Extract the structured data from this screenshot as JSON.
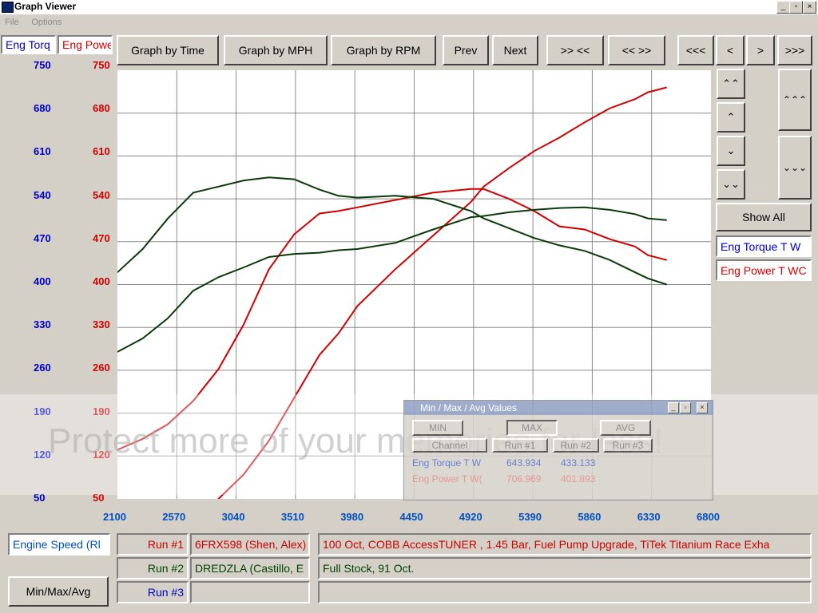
{
  "window": {
    "title": "Graph Viewer",
    "controls": [
      "_",
      "▫",
      "×"
    ]
  },
  "menu": [
    "File",
    "Options"
  ],
  "channels": {
    "torque": "Eng Torq",
    "power": "Eng Powe"
  },
  "toolbar": {
    "by_time": "Graph by Time",
    "by_mph": "Graph by MPH",
    "by_rpm": "Graph by RPM",
    "prev": "Prev",
    "next": "Next",
    "zoom_in": ">> <<",
    "zoom_out": "<< >>",
    "first": "<<<",
    "left": "<",
    "right": ">",
    "last": ">>>"
  },
  "side": {
    "show_all": "Show All",
    "legend_torque": "Eng Torque T W",
    "legend_power": "Eng Power T WC",
    "up2": "⌃⌃",
    "up1": "⌃",
    "down1": "⌄",
    "down2": "⌄⌄",
    "up3": "⌃⌃⌃",
    "down3": "⌄⌄⌄"
  },
  "axes": {
    "y_ticks": [
      "750",
      "680",
      "610",
      "540",
      "470",
      "400",
      "330",
      "260",
      "190",
      "120",
      "50"
    ],
    "x_ticks": [
      "2100",
      "2570",
      "3040",
      "3510",
      "3980",
      "4450",
      "4920",
      "5390",
      "5860",
      "6330",
      "6800"
    ]
  },
  "colors": {
    "torque_axis": "#0000c8",
    "power_axis": "#d00000",
    "run1": "#cc0000",
    "run2": "#004400",
    "plot_bg": "#ffffff"
  },
  "chart_data": {
    "type": "line",
    "xlabel": "Engine Speed",
    "ylim": [
      50,
      750
    ],
    "xlim": [
      2100,
      6800
    ],
    "grid": true,
    "series": [
      {
        "name": "Eng Power T WC (Run #1)",
        "x": [
          2100,
          2300,
          2500,
          2700,
          2900,
          3100,
          3300,
          3500,
          3700,
          3850,
          4000,
          4300,
          4600,
          4900,
          5000,
          5200,
          5400,
          5600,
          5800,
          6000,
          6200,
          6300,
          6450
        ],
        "y": [
          -50,
          -25,
          -5,
          20,
          50,
          90,
          145,
          215,
          285,
          320,
          365,
          425,
          480,
          535,
          560,
          590,
          618,
          640,
          665,
          688,
          703,
          714,
          722
        ]
      },
      {
        "name": "Eng Power T WC (Run #2)",
        "x": [
          2100,
          2300,
          2500,
          2700,
          2900,
          3100,
          3300,
          3500,
          3700,
          3850,
          4000,
          4300,
          4600,
          4900,
          5000,
          5200,
          5400,
          5600,
          5800,
          6000,
          6200,
          6300,
          6450
        ],
        "y": [
          130,
          148,
          172,
          210,
          262,
          335,
          425,
          482,
          516,
          520,
          526,
          538,
          550,
          556,
          556,
          540,
          520,
          495,
          490,
          474,
          462,
          448,
          440
        ]
      },
      {
        "name": "Eng Torque T W (Run #1)",
        "x": [
          2100,
          2300,
          2500,
          2700,
          2900,
          3100,
          3300,
          3500,
          3700,
          3850,
          4000,
          4300,
          4600,
          4900,
          5000,
          5200,
          5400,
          5600,
          5800,
          6000,
          6200,
          6300,
          6450
        ],
        "y": [
          290,
          312,
          345,
          390,
          412,
          428,
          445,
          450,
          452,
          456,
          458,
          468,
          490,
          510,
          512,
          518,
          522,
          525,
          526,
          522,
          515,
          508,
          505
        ]
      },
      {
        "name": "Eng Torque T W (Run #2)",
        "x": [
          2100,
          2300,
          2500,
          2700,
          2900,
          3100,
          3300,
          3500,
          3700,
          3850,
          4000,
          4300,
          4600,
          4900,
          5000,
          5200,
          5400,
          5600,
          5800,
          6000,
          6200,
          6300,
          6450
        ],
        "y": [
          420,
          458,
          508,
          550,
          560,
          570,
          575,
          572,
          555,
          545,
          542,
          545,
          540,
          520,
          508,
          492,
          476,
          464,
          455,
          440,
          420,
          410,
          400
        ]
      }
    ]
  },
  "dialog": {
    "title": "Min / Max / Avg Values",
    "min": "MIN",
    "max": "MAX",
    "avg": "AVG",
    "headers": [
      "Channel",
      "Run #1",
      "Run #2",
      "Run #3"
    ],
    "rows": [
      {
        "channel": "Eng Torque T W",
        "run1": "643.934",
        "run2": "433.133"
      },
      {
        "channel": "Eng Power T W(",
        "run1": "706.969",
        "run2": "401.893"
      }
    ]
  },
  "bottom": {
    "x_channel": "Engine Speed (Rl",
    "minmaxavg": "Min/Max/Avg",
    "runs": [
      {
        "label": "Run #1",
        "name": "6FRX598 (Shen, Alex)",
        "desc": "100 Oct, COBB AccessTUNER , 1.45 Bar, Fuel Pump Upgrade, TiTek Titanium Race Exha"
      },
      {
        "label": "Run #2",
        "name": "DREDZLA (Castillo, E",
        "desc": "Full Stock, 91 Oct."
      },
      {
        "label": "Run #3",
        "name": "",
        "desc": ""
      }
    ]
  },
  "watermark": "Protect more of your memories for less!"
}
